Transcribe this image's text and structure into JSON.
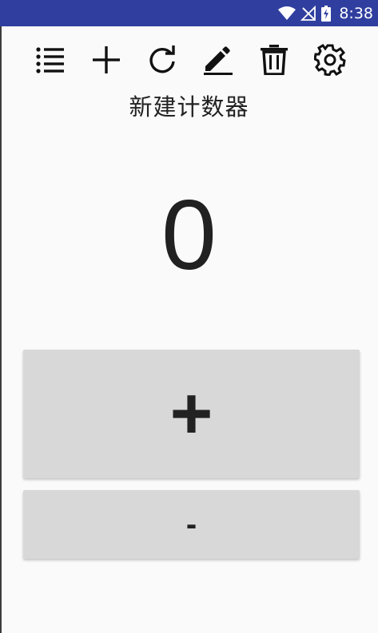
{
  "status_bar": {
    "time": "8:38",
    "bg_color": "#303f9f",
    "icons": [
      "wifi-icon",
      "no-signal-icon",
      "battery-charging-icon"
    ]
  },
  "toolbar": {
    "icons": [
      "list-icon",
      "add-icon",
      "refresh-icon",
      "edit-icon",
      "delete-icon",
      "settings-icon"
    ]
  },
  "counter": {
    "title": "新建计数器",
    "value": "0"
  },
  "buttons": {
    "increment_label": "+",
    "decrement_label": "-",
    "bg_color": "#d8d8d8"
  }
}
